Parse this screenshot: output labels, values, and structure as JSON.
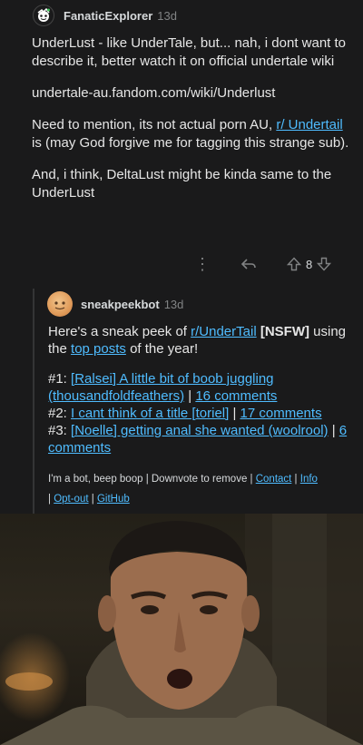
{
  "comment1": {
    "author": "FanaticExplorer",
    "age": "13d",
    "para1": "UnderLust - like UnderTale, but... nah, i dont want to describe it, better watch it on official undertale wiki",
    "para2": "undertale-au.fandom.com/wiki/Underlust",
    "para3_before": "Need to mention, its not actual porn AU, ",
    "para3_link": "r/ Undertail",
    "para3_after": " is (may God forgive me for tagging this strange sub).",
    "para4": "And, i think, DeltaLust might be kinda same to the UnderLust",
    "score": "8"
  },
  "comment2": {
    "author": "sneakpeekbot",
    "age": "13d",
    "intro_a": "Here's a sneak peek of ",
    "intro_sub": "r/UnderTail",
    "intro_nsfw": " [NSFW]",
    "intro_b": " using the ",
    "intro_top": "top posts",
    "intro_c": " of the year!",
    "posts": [
      {
        "num": "#1: ",
        "title": "[Ralsei] A little bit of boob juggling (thousandfoldfeathers)",
        "sep": " | ",
        "comments": "16 comments"
      },
      {
        "num": "#2: ",
        "title": "I cant think of a title [toriel]",
        "sep": " | ",
        "comments": "17 comments"
      },
      {
        "num": "#3: ",
        "title": "[Noelle] getting anal she wanted (woolrool)",
        "sep": " | ",
        "comments": "6 comments"
      }
    ],
    "footer_text": "I'm a bot, beep boop | Downvote to remove | ",
    "footer_contact": "Contact",
    "footer_sep1": " | ",
    "footer_info": "Info",
    "footer_sep2": " | ",
    "footer_optout": "Opt-out",
    "footer_sep3": " | ",
    "footer_github": "GitHub"
  }
}
